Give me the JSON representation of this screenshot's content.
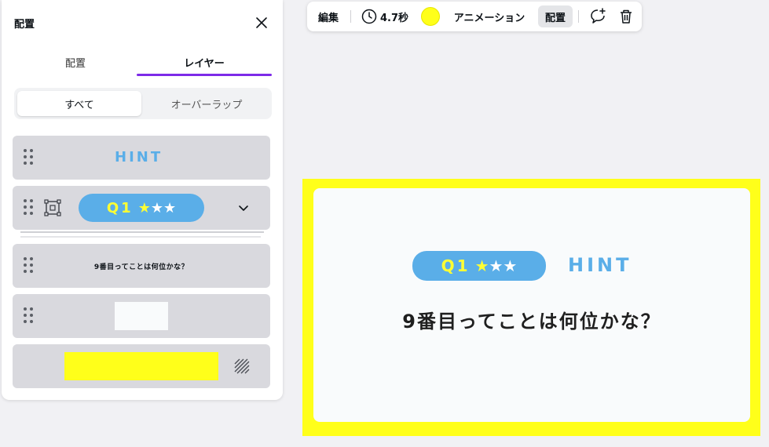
{
  "panel": {
    "title": "配置",
    "tabs": [
      {
        "label": "配置",
        "active": false
      },
      {
        "label": "レイヤー",
        "active": true
      }
    ],
    "filter": [
      {
        "label": "すべて",
        "active": true
      },
      {
        "label": "オーバーラップ",
        "active": false
      }
    ],
    "layers": [
      {
        "type": "text",
        "text": "HINT"
      },
      {
        "type": "group",
        "q_label": "Q1",
        "stars_on": "★",
        "stars_off": "★★"
      },
      {
        "type": "text",
        "text": "9番目ってことは何位かな？"
      },
      {
        "type": "shape",
        "color": "#f9fbfc"
      },
      {
        "type": "background",
        "color": "#ffff1a"
      }
    ]
  },
  "toolbar": {
    "edit_label": "編集",
    "time_label": "4.7秒",
    "color": "#ffff1a",
    "animation_label": "アニメーション",
    "arrange_label": "配置"
  },
  "canvas": {
    "background": "#ffff1a",
    "card_color": "#f9fbfc",
    "q_label": "Q1",
    "stars_on": "★",
    "stars_off": "★★",
    "hint_text": "HINT",
    "question": "9番目ってことは何位かな？"
  },
  "colors": {
    "accent": "#7d2ae8",
    "pill": "#5aaee8",
    "star_yellow": "#ffff33"
  }
}
